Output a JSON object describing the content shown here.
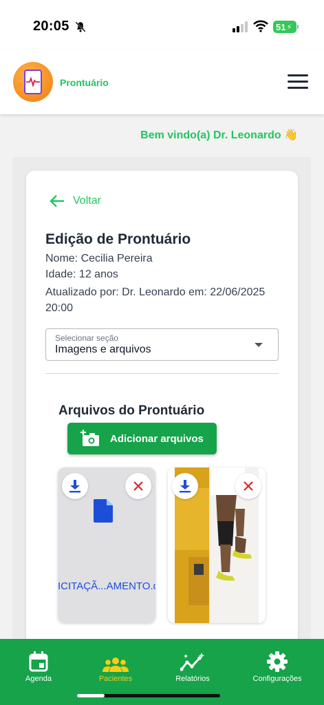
{
  "status_bar": {
    "time": "20:05",
    "battery": "51"
  },
  "header": {
    "app_title": "Prontuário"
  },
  "welcome": "Bem vindo(a) Dr. Leonardo 👋",
  "back": {
    "label": "Voltar"
  },
  "record": {
    "title": "Edição de Prontuário",
    "name": "Nome: Cecilia Pereira",
    "age": "Idade: 12 anos",
    "updated": "Atualizado por: Dr. Leonardo em: 22/06/2025 20:00"
  },
  "section_select": {
    "label": "Selecionar seção",
    "value": "Imagens e arquivos"
  },
  "files": {
    "title": "Arquivos do Prontuário",
    "add_label": "Adicionar arquivos",
    "items": [
      {
        "name": "OLICITAÇÃ...AMENTO.do",
        "type": "document"
      },
      {
        "type": "image"
      }
    ]
  },
  "nav": {
    "items": [
      {
        "label": "Agenda",
        "icon": "calendar-icon"
      },
      {
        "label": "Pacientes",
        "icon": "people-icon",
        "active": true
      },
      {
        "label": "Relatórios",
        "icon": "chart-icon"
      },
      {
        "label": "Configurações",
        "icon": "gear-icon"
      }
    ]
  },
  "colors": {
    "brand_green": "#16a34a",
    "accent_green": "#22c55e",
    "active_nav": "#facc15",
    "link_blue": "#1d4ed8"
  }
}
